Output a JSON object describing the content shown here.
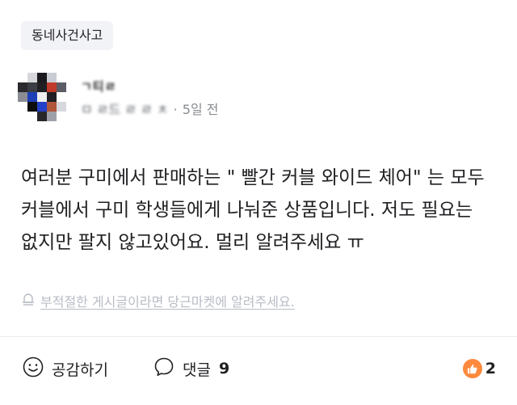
{
  "category": "동네사건사고",
  "author": {
    "name": "ㄱ티ㄹ",
    "location": "ㅁ ㄹ드 ㄹ ㄹ ㅊ",
    "time_ago": "5일 전"
  },
  "post": {
    "body": "여러분 구미에서 판매하는 \" 빨간 커블 와이드 체어\" 는 모두 커블에서 구미 학생들에게 나눠준 상품입니다. 저도 필요는 없지만 팔지 않고있어요. 멀리 알려주세요 ㅠ"
  },
  "report": {
    "text": "부적절한 게시글이라면 당근마켓에 알려주세요."
  },
  "actions": {
    "empathy_label": "공감하기",
    "comment_label": "댓글",
    "comment_count": "9",
    "reaction_count": "2"
  },
  "colors": {
    "accent": "#ff8a3d",
    "muted": "#898c92",
    "chip_bg": "#f2f3f6"
  }
}
